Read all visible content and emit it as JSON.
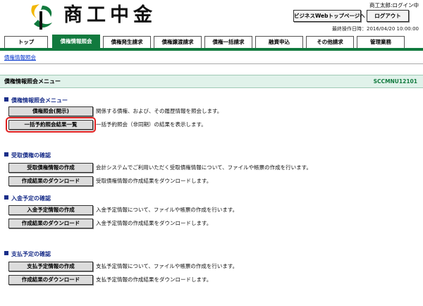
{
  "header": {
    "logo_text": "商工中金",
    "user_status": "商工太郎:ログイン中",
    "top_page_button": "ビジネスWebトップページへ",
    "logout_button": "ログアウト",
    "last_operation": "最終操作日時：2016/04/20 10:00:00"
  },
  "tabs": [
    {
      "label": "トップ",
      "active": false
    },
    {
      "label": "債権情報照会",
      "active": true
    },
    {
      "label": "債権発生請求",
      "active": false
    },
    {
      "label": "債権譲渡請求",
      "active": false
    },
    {
      "label": "債権一括請求",
      "active": false
    },
    {
      "label": "融資申込",
      "active": false
    },
    {
      "label": "その他請求",
      "active": false
    },
    {
      "label": "管理業務",
      "active": false
    }
  ],
  "breadcrumb": "債権情報照会",
  "page": {
    "title": "債権情報照会メニュー",
    "code": "SCCMNU12101"
  },
  "sections": [
    {
      "heading": "債権情報照会メニュー",
      "rows": [
        {
          "button": "債権照会(開示)",
          "desc": "関係する債権、および、その履歴情報を照会します。"
        },
        {
          "button": "一括予約照会結果一覧",
          "desc": "一括予約照会（非同期）の結果を表示します。"
        }
      ]
    },
    {
      "heading": "受取債権の確認",
      "rows": [
        {
          "button": "受取債権情報の作成",
          "desc": "会計システムでご利用いただく受取債権情報について、ファイルや帳票の作成を行います。"
        },
        {
          "button": "作成結果のダウンロード",
          "desc": "受取債権情報の作成結果をダウンロードします。"
        }
      ]
    },
    {
      "heading": "入金予定の確認",
      "rows": [
        {
          "button": "入金予定情報の作成",
          "desc": "入金予定情報について、ファイルや帳票の作成を行います。"
        },
        {
          "button": "作成結果のダウンロード",
          "desc": "入金予定情報の作成結果をダウンロードします。"
        }
      ]
    },
    {
      "heading": "支払予定の確認",
      "rows": [
        {
          "button": "支払予定情報の作成",
          "desc": "支払予定情報について、ファイルや帳票の作成を行います。"
        },
        {
          "button": "作成結果のダウンロード",
          "desc": "支払予定情報の作成結果をダウンロードします。"
        }
      ]
    }
  ],
  "colors": {
    "brand_green": "#117a3e",
    "logo_yellow": "#f2b705",
    "heading_blue": "#1a2f8a",
    "highlight_red": "#e02020"
  }
}
